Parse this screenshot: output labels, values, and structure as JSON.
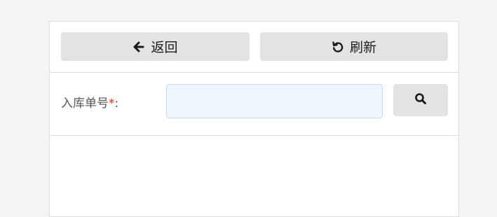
{
  "toolbar": {
    "back_label": "返回",
    "back_icon": "arrow-left-icon",
    "refresh_label": "刷新",
    "refresh_icon": "refresh-icon"
  },
  "form": {
    "field_label": "入库单号",
    "required_mark": "*",
    "colon": ":",
    "input_value": "",
    "input_placeholder": "",
    "search_icon": "search-icon"
  },
  "colors": {
    "page_bg": "#f4f4f4",
    "button_bg": "#e3e3e3",
    "input_bg": "#eef5fd",
    "required": "#e02020"
  }
}
